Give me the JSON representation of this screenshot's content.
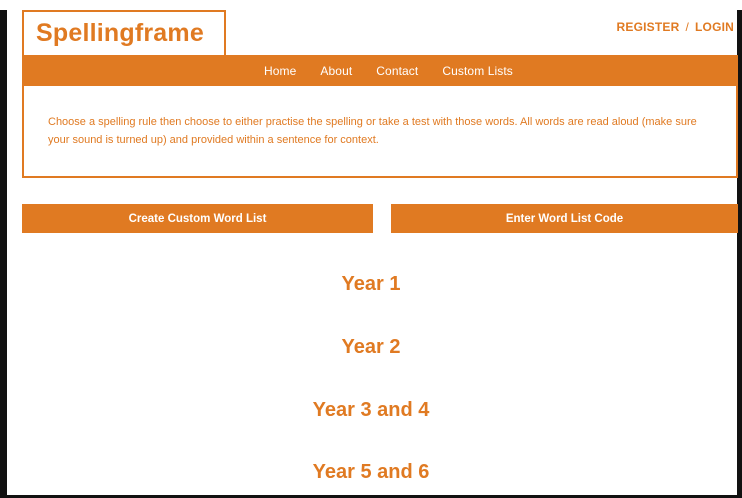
{
  "header": {
    "logo_text": "Spellingframe",
    "register_label": "REGISTER",
    "separator": "/",
    "login_label": "LOGIN"
  },
  "nav": {
    "items": [
      {
        "label": "Home"
      },
      {
        "label": "About"
      },
      {
        "label": "Contact"
      },
      {
        "label": "Custom Lists"
      }
    ]
  },
  "intro": {
    "text": "Choose a spelling rule then choose to either practise the spelling or take a test with those words. All words are read aloud (make sure your sound is turned up) and provided within a sentence for context."
  },
  "actions": {
    "create_label": "Create Custom Word List",
    "code_label": "Enter Word List Code"
  },
  "years": [
    {
      "label": "Year 1"
    },
    {
      "label": "Year 2"
    },
    {
      "label": "Year 3 and 4"
    },
    {
      "label": "Year 5 and 6"
    }
  ],
  "colors": {
    "accent": "#e07a22",
    "frame": "#111111",
    "background": "#ffffff"
  }
}
